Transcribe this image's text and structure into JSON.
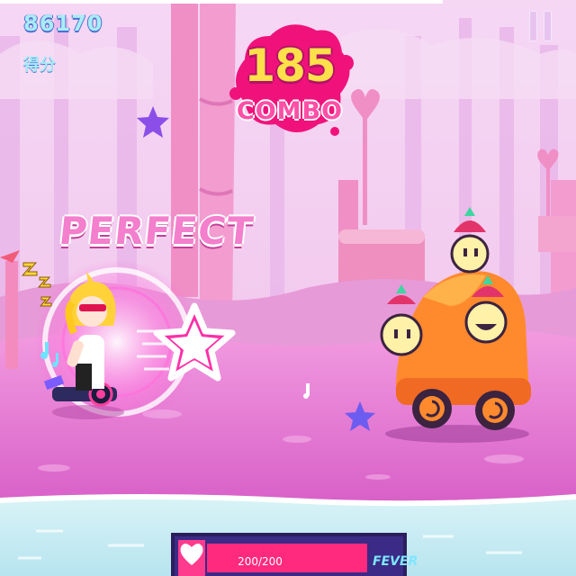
{
  "hud": {
    "score": "86170",
    "score_label": "得分",
    "combo_count": "185",
    "combo_label": "COMBO",
    "judgement": "PERFECT"
  },
  "fever": {
    "value_text": "200/200",
    "label": "FEVER",
    "fill_fraction": 1.0
  },
  "icons": {
    "pause": "pause-icon",
    "note": "star-note-icon",
    "heart": "heart-icon",
    "sleep": "zzz-icon"
  },
  "colors": {
    "sky": "#f3c9ef",
    "ground": "#e87fd6",
    "river": "#c6ecf3",
    "accent_pink": "#ff4fa6",
    "combo_yellow": "#ffe04a",
    "score_cyan": "#a9ecf6"
  }
}
